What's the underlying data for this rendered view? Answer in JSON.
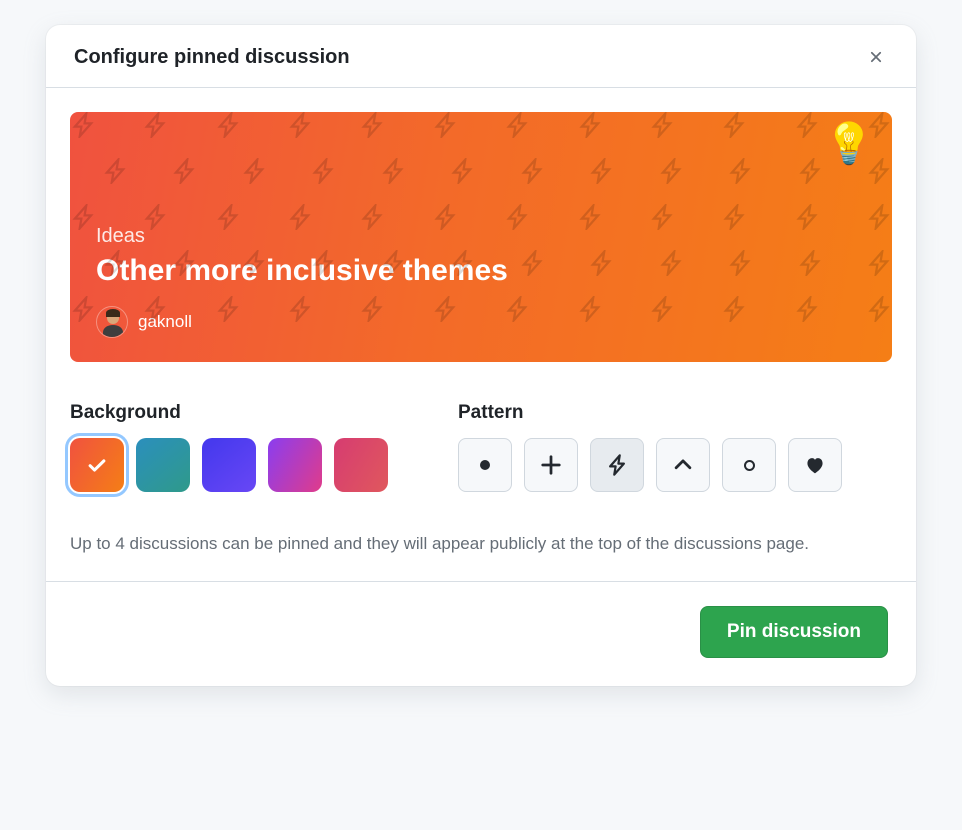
{
  "dialog": {
    "title": "Configure pinned discussion"
  },
  "preview": {
    "category": "Ideas",
    "title": "Other more inclusive themes",
    "author": "gaknoll",
    "emoji_icon": "💡"
  },
  "controls": {
    "background_label": "Background",
    "pattern_label": "Pattern",
    "background_options": [
      {
        "id": "red-orange",
        "selected": true
      },
      {
        "id": "teal-blue",
        "selected": false
      },
      {
        "id": "indigo-violet",
        "selected": false
      },
      {
        "id": "purple-pink",
        "selected": false
      },
      {
        "id": "pink-red",
        "selected": false
      }
    ],
    "pattern_options": [
      {
        "id": "dot",
        "selected": false
      },
      {
        "id": "plus",
        "selected": false
      },
      {
        "id": "zap",
        "selected": true
      },
      {
        "id": "chevron-up",
        "selected": false
      },
      {
        "id": "circle",
        "selected": false
      },
      {
        "id": "heart",
        "selected": false
      }
    ]
  },
  "helper_text": "Up to 4 discussions can be pinned and they will appear publicly at the top of the discussions page.",
  "footer": {
    "submit_label": "Pin discussion"
  }
}
